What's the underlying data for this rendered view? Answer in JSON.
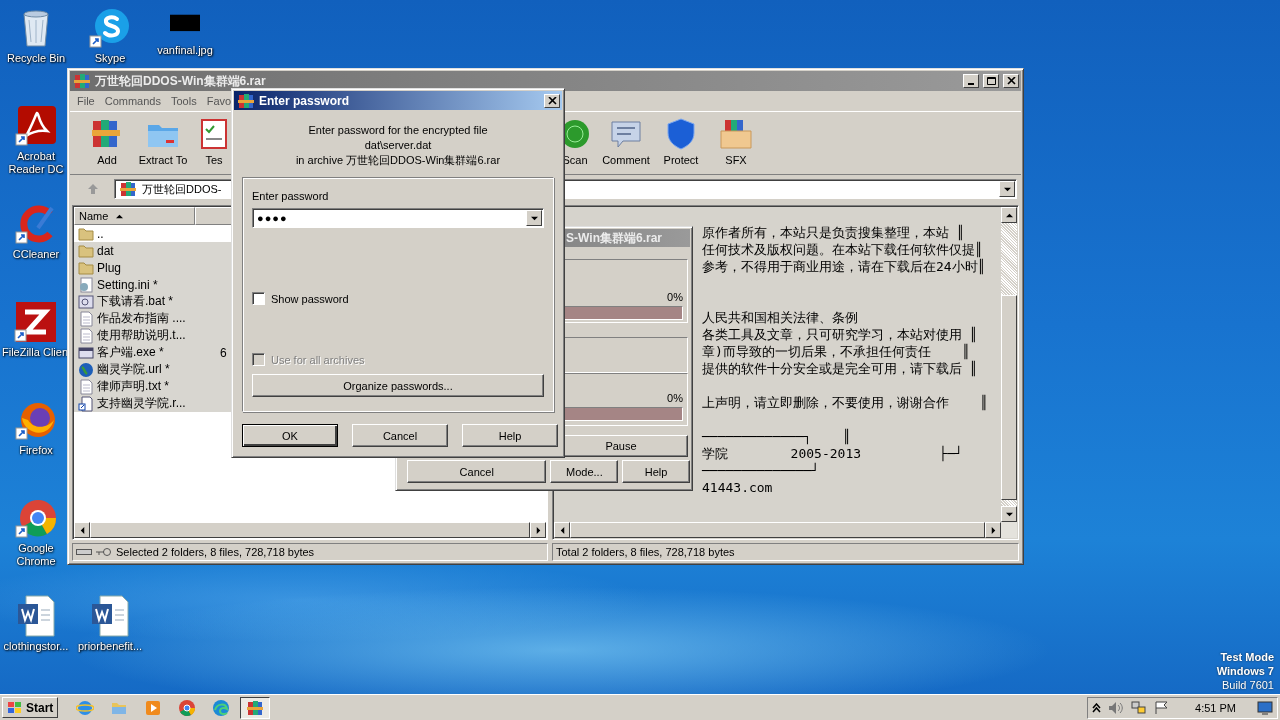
{
  "desktop_icons": [
    {
      "label": "Recycle Bin",
      "kind": "recycle",
      "shortcut": false
    },
    {
      "label": "Skype",
      "kind": "skype",
      "shortcut": true
    },
    {
      "label": "vanfinal.jpg",
      "kind": "image",
      "shortcut": false
    },
    {
      "label": "Acrobat Reader DC",
      "kind": "acrobat",
      "shortcut": true
    },
    {
      "label": "CCleaner",
      "kind": "ccleaner",
      "shortcut": true
    },
    {
      "label": "FileZilla Clien",
      "kind": "filezilla",
      "shortcut": true
    },
    {
      "label": "Firefox",
      "kind": "firefox",
      "shortcut": true
    },
    {
      "label": "Google Chrome",
      "kind": "chrome",
      "shortcut": true
    },
    {
      "label": "clothingstor...",
      "kind": "word",
      "shortcut": false
    },
    {
      "label": "priorbenefit...",
      "kind": "word",
      "shortcut": false
    }
  ],
  "main_window": {
    "title": "万世轮回DDOS-Win集群端6.rar",
    "active": false,
    "menu": [
      "File",
      "Commands",
      "Tools",
      "Favo"
    ],
    "toolbar_left": [
      {
        "label": "Add",
        "kind": "add"
      },
      {
        "label": "Extract To",
        "kind": "extract"
      },
      {
        "label": "Tes",
        "kind": "test"
      }
    ],
    "toolbar_right": [
      {
        "label": "Scan",
        "kind": "scan"
      },
      {
        "label": "Comment",
        "kind": "comment"
      },
      {
        "label": "Protect",
        "kind": "protect"
      },
      {
        "label": "SFX",
        "kind": "sfx"
      }
    ],
    "address": "万世轮回DDOS-",
    "file_list": {
      "columns": [
        "Name"
      ],
      "rows": [
        {
          "name": "..",
          "kind": "folder",
          "selected": false
        },
        {
          "name": "dat",
          "kind": "folder",
          "selected": true
        },
        {
          "name": "Plug",
          "kind": "folder",
          "selected": true
        },
        {
          "name": "Setting.ini *",
          "kind": "ini",
          "selected": true
        },
        {
          "name": "下载请看.bat *",
          "kind": "bat",
          "selected": true
        },
        {
          "name": "作品发布指南 ....",
          "kind": "txt",
          "selected": true
        },
        {
          "name": "使用帮助说明.t...",
          "kind": "txt",
          "selected": true
        },
        {
          "name": "客户端.exe *",
          "kind": "exe",
          "selected": true,
          "size": "6"
        },
        {
          "name": "幽灵学院.url *",
          "kind": "url",
          "selected": true
        },
        {
          "name": "律师声明.txt *",
          "kind": "txt",
          "selected": true
        },
        {
          "name": "支持幽灵学院.r...",
          "kind": "link",
          "selected": true
        }
      ]
    },
    "viewer_text": [
      [
        "原作者所有，本站只是负责搜集整理，本站 ║",
        "任何技术及版权问题。在本站下载任何软件仅提║",
        "参考，不得用于商业用途，请在下载后在24小时║"
      ],
      [
        "人民共和国相关法律、条例",
        "各类工具及文章，只可研究学习，本站对使用 ║",
        "章)而导致的一切后果，不承担任何责任    ║",
        "提供的软件十分安全或是完全可用，请下载后 ║"
      ],
      [
        "上声明，请立即删除，不要使用，谢谢合作    ║"
      ],
      [
        "─────────────┐    ║",
        "学院        2005-2013          ├─┘",
        "──────────────┘",
        "41443.com"
      ]
    ],
    "status_left": "Selected 2 folders, 8 files, 728,718 bytes",
    "status_right": "Total 2 folders, 8 files, 728,718 bytes"
  },
  "progress_dialog": {
    "title": "S-Win集群端6.rar",
    "active": false,
    "progress": [
      {
        "reading": "0%",
        "level": 0
      },
      {
        "reading": "0%",
        "level": 0
      }
    ],
    "pause": "Pause",
    "buttons": [
      "Cancel",
      "Mode...",
      "Help"
    ]
  },
  "password_dialog": {
    "title": "Enter password",
    "active": true,
    "message": [
      "Enter password for the encrypted file",
      "dat\\server.dat",
      "in archive 万世轮回DDOS-Win集群端6.rar"
    ],
    "field_label": "Enter password",
    "value": "●●●●",
    "show_password": {
      "label": "Show password",
      "checked": false,
      "disabled": false
    },
    "use_for_all": {
      "label": "Use for all archives",
      "checked": false,
      "disabled": true
    },
    "organize": "Organize passwords...",
    "buttons": [
      "OK",
      "Cancel",
      "Help"
    ]
  },
  "taskbar": {
    "start": "Start",
    "apps": [
      {
        "kind": "ie",
        "selected": false
      },
      {
        "kind": "explorer",
        "selected": false
      },
      {
        "kind": "media",
        "selected": false
      },
      {
        "kind": "chrome",
        "selected": false
      },
      {
        "kind": "edge",
        "selected": false
      },
      {
        "kind": "winrar",
        "selected": true
      }
    ],
    "clock": "4:51 PM"
  },
  "os_notice": [
    "Test Mode",
    "Windows 7",
    "Build 7601"
  ]
}
